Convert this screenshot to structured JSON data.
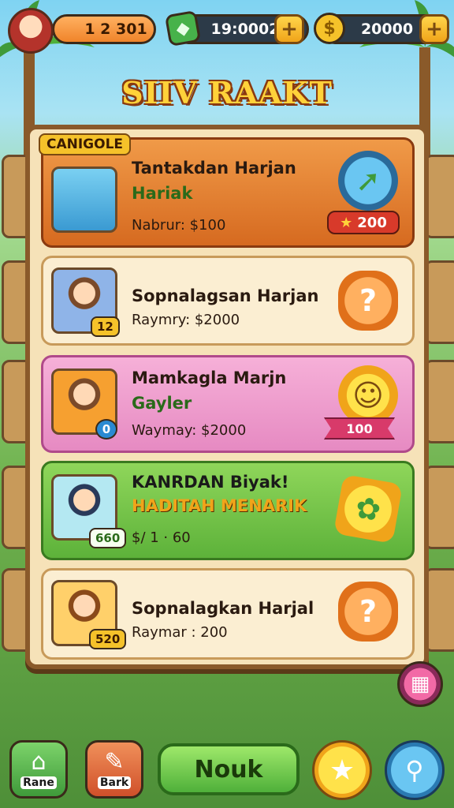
{
  "hud": {
    "xp_value": "1 2 301",
    "gems_value": "19:0002",
    "coins_value": "20000",
    "plus_symbol": "+"
  },
  "screen_title": "SIIV RAAKT",
  "quests": [
    {
      "tag": "CANIGOLE",
      "title": "Tantakdan Harjan",
      "subtitle": "Hariak",
      "reward": "Nabrur: $100",
      "portrait_badge": "",
      "reward_value": "200",
      "icon": "globe-arrow-icon"
    },
    {
      "title": "Sopnalagsan Harjan",
      "reward": "Raymry: $2000",
      "portrait_badge": "12",
      "icon": "question-badge-icon"
    },
    {
      "title": "Mamkagla Marjn",
      "subtitle": "Gayler",
      "reward": "Waymay: $2000",
      "portrait_badge": "0",
      "reward_value": "100",
      "icon": "sun-badge-icon"
    },
    {
      "title": "KANRDAN Biyak!",
      "subtitle": "HADITAH MENARIK",
      "reward": "$/ 1 · 60",
      "portrait_badge": "660",
      "icon": "frog-star-icon"
    },
    {
      "title": "Sopnalagkan Harjal",
      "reward": "Raymar : 200",
      "portrait_badge": "520",
      "icon": "question-badge-icon"
    }
  ],
  "nav": {
    "home_label": "Rane",
    "back_label": "Bark",
    "main_label": "Nouk"
  },
  "colors": {
    "accent_orange": "#d66a20",
    "accent_green": "#5db23a",
    "accent_pink": "#e68ac2",
    "title_yellow": "#ffd23a"
  }
}
